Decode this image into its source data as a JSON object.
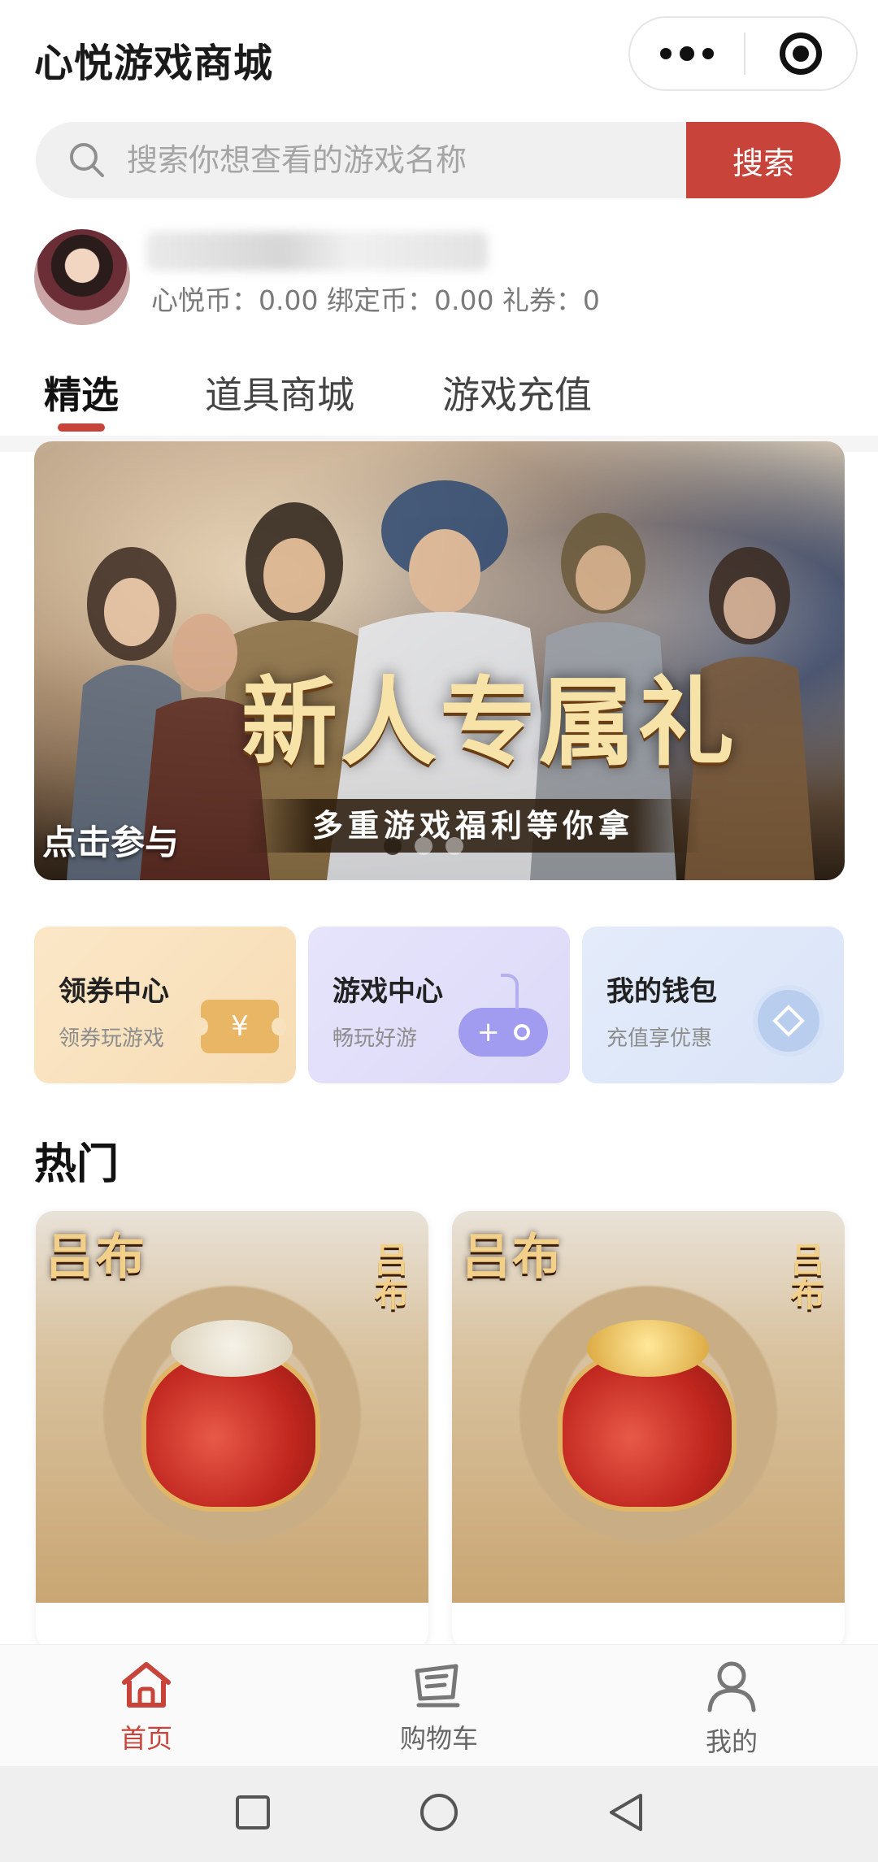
{
  "header": {
    "title": "心悦游戏商城"
  },
  "search": {
    "placeholder": "搜索你想查看的游戏名称",
    "button_label": "搜索"
  },
  "profile": {
    "balances": "心悦币：0.00 绑定币：0.00 礼券：0"
  },
  "tabs": [
    {
      "label": "精选",
      "active": true
    },
    {
      "label": "道具商城",
      "active": false
    },
    {
      "label": "游戏充值",
      "active": false
    }
  ],
  "banner": {
    "cta": "点击参与",
    "title": "新人专属礼",
    "subtitle": "多重游戏福利等你拿",
    "dots": 3,
    "active_dot": 0
  },
  "features": [
    {
      "title": "领券中心",
      "subtitle": "领券玩游戏",
      "icon": "ticket-icon",
      "badge": "¥"
    },
    {
      "title": "游戏中心",
      "subtitle": "畅玩好游",
      "icon": "gamepad-icon",
      "badge": "+"
    },
    {
      "title": "我的钱包",
      "subtitle": "充值享优惠",
      "icon": "wallet-diamond-icon"
    }
  ],
  "hot": {
    "title": "热门",
    "products": [
      {
        "logo_text": "吕布",
        "logo_vertical": "吕布"
      },
      {
        "logo_text": "吕布",
        "logo_vertical": "吕布"
      }
    ]
  },
  "tabbar": {
    "items": [
      {
        "label": "首页",
        "icon": "home-icon",
        "active": true
      },
      {
        "label": "购物车",
        "icon": "cart-icon",
        "active": false
      },
      {
        "label": "我的",
        "icon": "user-icon",
        "active": false
      }
    ]
  },
  "colors": {
    "accent": "#c8443a",
    "search_bg": "#f0f0f0"
  }
}
